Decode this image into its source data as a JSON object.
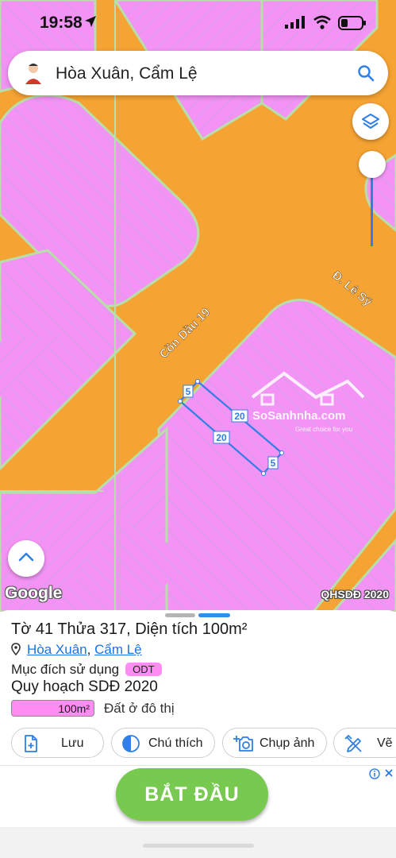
{
  "status_bar": {
    "time": "19:58"
  },
  "search": {
    "text": "Hòa Xuân, Cẩm Lệ"
  },
  "map": {
    "street_labels": [
      "Cồn Dầu 19",
      "Đ. Lê Sỹ"
    ],
    "dimension_labels": {
      "short_top": "5",
      "long_top": "20",
      "long_bottom": "20",
      "short_bottom": "5"
    },
    "watermark": {
      "brand": "SoSanhnha.com",
      "tagline": "Great choice for you"
    },
    "google": "Google",
    "source": "QHSDĐ 2020",
    "colors": {
      "road": "#f5a333",
      "land": "#f493f5",
      "parcel_outline": "#2f7fe4"
    }
  },
  "parcel": {
    "title": "Tờ 41 Thửa 317, Diện tích 100m²",
    "ward": "Hòa Xuân",
    "separator": ",",
    "district": "Cẩm Lệ",
    "purpose_label": "Mục đích sử dụng",
    "purpose_code": "ODT",
    "plan_title": "Quy hoạch SDĐ 2020",
    "area_value": "100m²",
    "area_desc": "Đất ở đô thị"
  },
  "actions": {
    "save": "Lưu",
    "legend": "Chú thích",
    "photo": "Chụp ảnh",
    "draw": "Vẽ"
  },
  "ad": {
    "button": "BẮT ĐẦU"
  }
}
